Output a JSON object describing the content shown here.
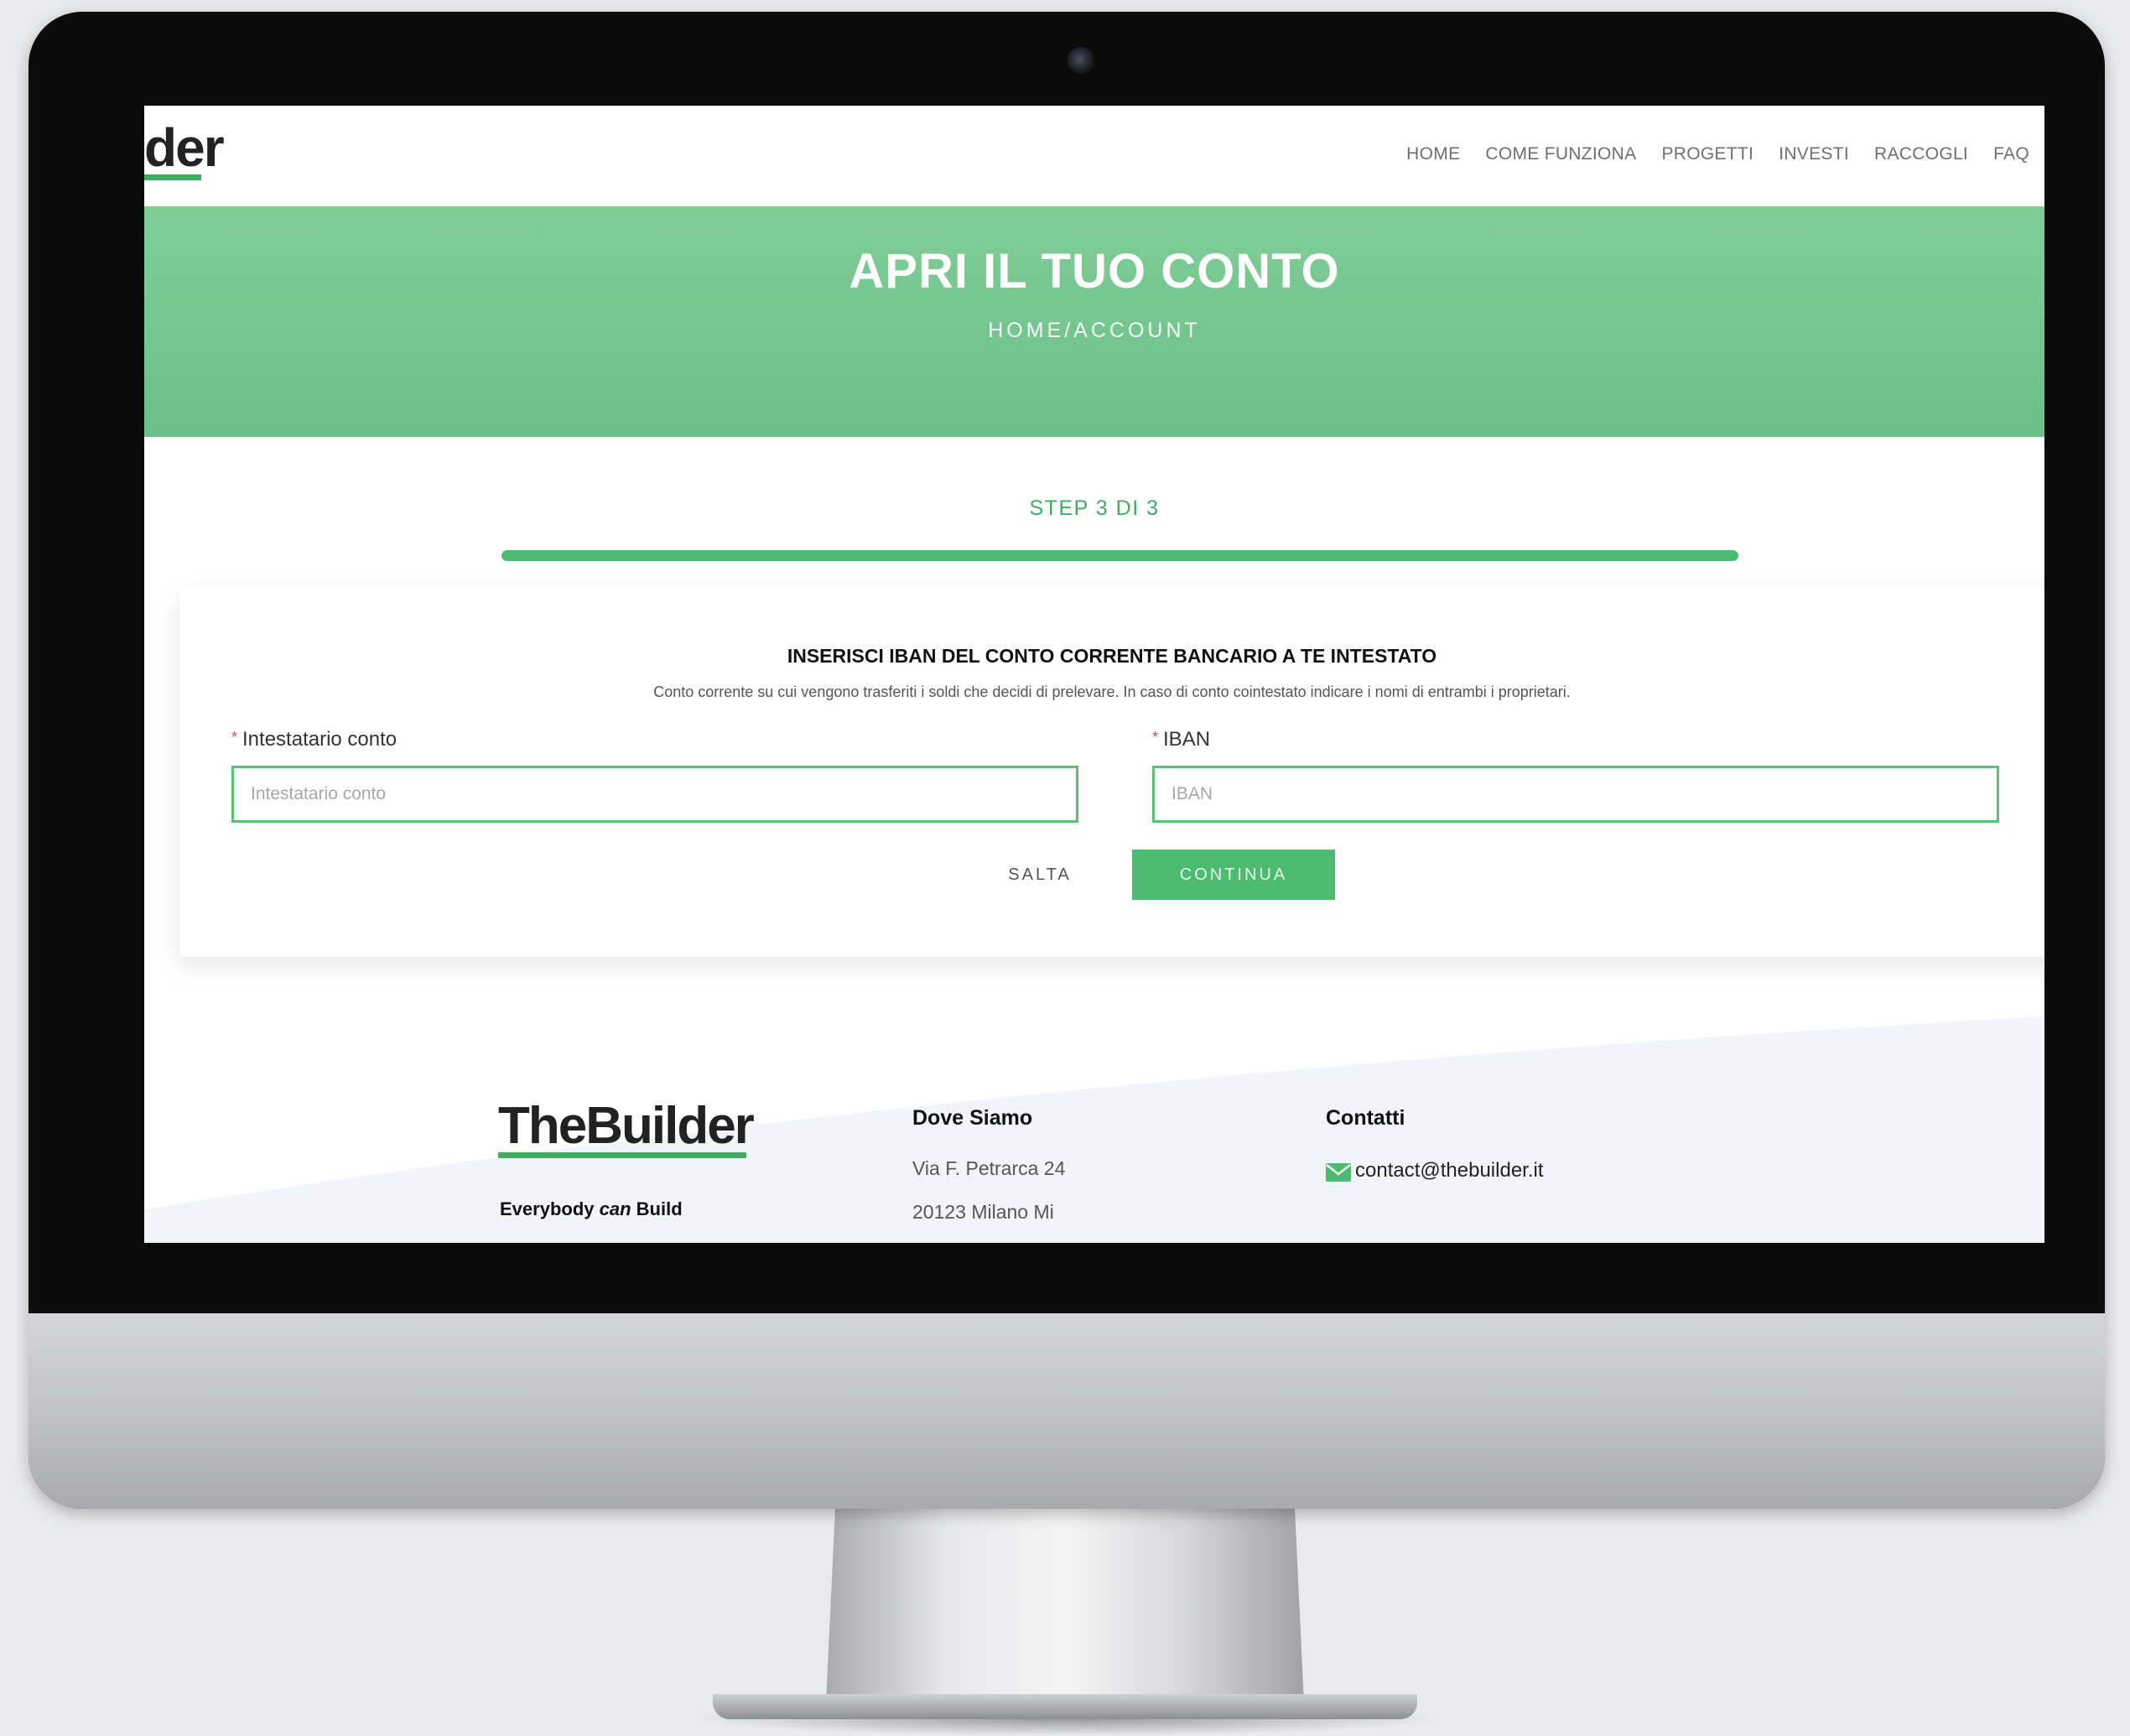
{
  "nav": {
    "logo_fragment": "der",
    "items": [
      "HOME",
      "COME FUNZIONA",
      "PROGETTI",
      "INVESTI",
      "RACCOGLI",
      "FAQ"
    ]
  },
  "hero": {
    "title": "APRI IL TUO CONTO",
    "breadcrumb": "HOME/ACCOUNT"
  },
  "step": {
    "label": "STEP 3 DI 3",
    "progress_fraction": 1.0
  },
  "form": {
    "title": "INSERISCI IBAN DEL CONTO CORRENTE BANCARIO A TE INTESTATO",
    "subtitle": "Conto corrente su cui vengono trasferiti i soldi che decidi di prelevare. In caso di conto cointestato indicare i nomi di entrambi i proprietari.",
    "required_mark": "*",
    "holder": {
      "label": "Intestatario conto",
      "placeholder": "Intestatario conto",
      "value": ""
    },
    "iban": {
      "label": "IBAN",
      "placeholder": "IBAN",
      "value": ""
    },
    "skip_label": "SALTA",
    "continue_label": "CONTINUA"
  },
  "footer": {
    "logo_the": "The",
    "logo_builder": "Builder",
    "tagline_1": "Everybody ",
    "tagline_2": "can",
    "tagline_3": " Build",
    "location_title": "Dove Siamo",
    "address_line_1": "Via F. Petrarca 24",
    "address_line_2": "20123 Milano Mi",
    "contacts_title": "Contatti",
    "email": "contact@thebuilder.it"
  },
  "colors": {
    "brand_green": "#4dbb6f",
    "hero_green": "#78c994",
    "required_red": "#e14b4b"
  },
  "icons": [
    "envelope-icon",
    "camera-icon"
  ]
}
